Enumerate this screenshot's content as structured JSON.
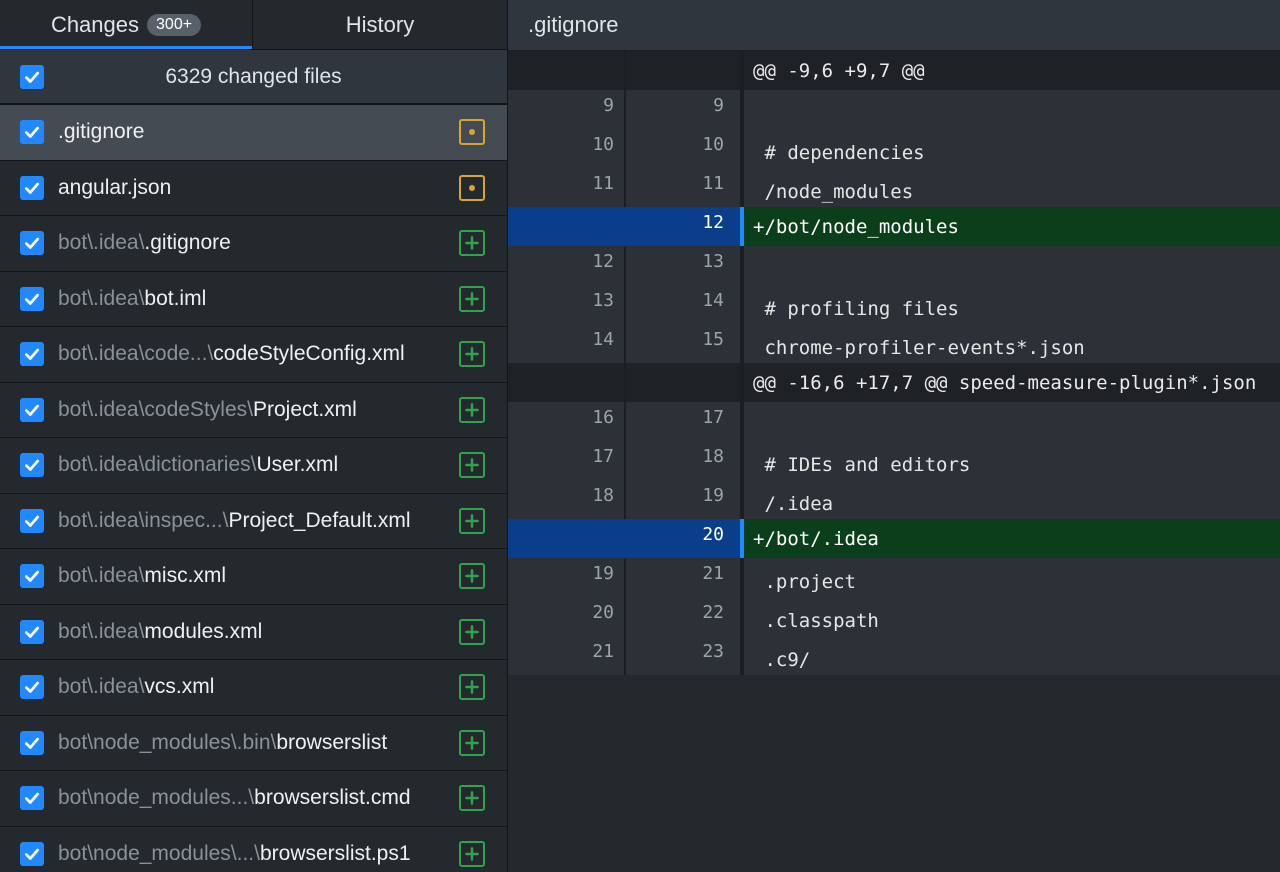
{
  "tabs": {
    "changes_label": "Changes",
    "changes_count": "300+",
    "history_label": "History"
  },
  "select_all": {
    "label": "6329 changed files",
    "checked": true
  },
  "files": [
    {
      "dir": "",
      "name": ".gitignore",
      "status": "modified",
      "selected": true
    },
    {
      "dir": "",
      "name": "angular.json",
      "status": "modified",
      "selected": false
    },
    {
      "dir": "bot\\.idea\\",
      "name": ".gitignore",
      "status": "added",
      "selected": false
    },
    {
      "dir": "bot\\.idea\\",
      "name": "bot.iml",
      "status": "added",
      "selected": false
    },
    {
      "dir": "bot\\.idea\\code...\\",
      "name": "codeStyleConfig.xml",
      "status": "added",
      "selected": false
    },
    {
      "dir": "bot\\.idea\\codeStyles\\",
      "name": "Project.xml",
      "status": "added",
      "selected": false
    },
    {
      "dir": "bot\\.idea\\dictionaries\\",
      "name": "User.xml",
      "status": "added",
      "selected": false
    },
    {
      "dir": "bot\\.idea\\inspec...\\",
      "name": "Project_Default.xml",
      "status": "added",
      "selected": false
    },
    {
      "dir": "bot\\.idea\\",
      "name": "misc.xml",
      "status": "added",
      "selected": false
    },
    {
      "dir": "bot\\.idea\\",
      "name": "modules.xml",
      "status": "added",
      "selected": false
    },
    {
      "dir": "bot\\.idea\\",
      "name": "vcs.xml",
      "status": "added",
      "selected": false
    },
    {
      "dir": "bot\\node_modules\\.bin\\",
      "name": "browserslist",
      "status": "added",
      "selected": false
    },
    {
      "dir": "bot\\node_modules...\\",
      "name": "browserslist.cmd",
      "status": "added",
      "selected": false
    },
    {
      "dir": "bot\\node_modules\\...\\",
      "name": "browserslist.ps1",
      "status": "added",
      "selected": false
    }
  ],
  "diff": {
    "file_name": ".gitignore",
    "lines": [
      {
        "type": "hunk",
        "old": "",
        "new": "",
        "text": "@@ -9,6 +9,7 @@"
      },
      {
        "type": "ctx",
        "old": "9",
        "new": "9",
        "text": ""
      },
      {
        "type": "ctx",
        "old": "10",
        "new": "10",
        "text": " # dependencies"
      },
      {
        "type": "ctx",
        "old": "11",
        "new": "11",
        "text": " /node_modules"
      },
      {
        "type": "add",
        "old": "",
        "new": "12",
        "text": "+/bot/node_modules"
      },
      {
        "type": "ctx",
        "old": "12",
        "new": "13",
        "text": ""
      },
      {
        "type": "ctx",
        "old": "13",
        "new": "14",
        "text": " # profiling files"
      },
      {
        "type": "ctx",
        "old": "14",
        "new": "15",
        "text": " chrome-profiler-events*.json"
      },
      {
        "type": "hunk",
        "old": "",
        "new": "",
        "text": "@@ -16,6 +17,7 @@ speed-measure-plugin*.json"
      },
      {
        "type": "ctx",
        "old": "16",
        "new": "17",
        "text": ""
      },
      {
        "type": "ctx",
        "old": "17",
        "new": "18",
        "text": " # IDEs and editors"
      },
      {
        "type": "ctx",
        "old": "18",
        "new": "19",
        "text": " /.idea"
      },
      {
        "type": "add",
        "old": "",
        "new": "20",
        "text": "+/bot/.idea"
      },
      {
        "type": "ctx",
        "old": "19",
        "new": "21",
        "text": " .project"
      },
      {
        "type": "ctx",
        "old": "20",
        "new": "22",
        "text": " .classpath"
      },
      {
        "type": "ctx",
        "old": "21",
        "new": "23",
        "text": " .c9/"
      }
    ]
  },
  "colors": {
    "accent": "#2188ff",
    "modified": "#d7a62a",
    "added": "#2ea44f",
    "added_line_bg": "#0b3f1c"
  }
}
